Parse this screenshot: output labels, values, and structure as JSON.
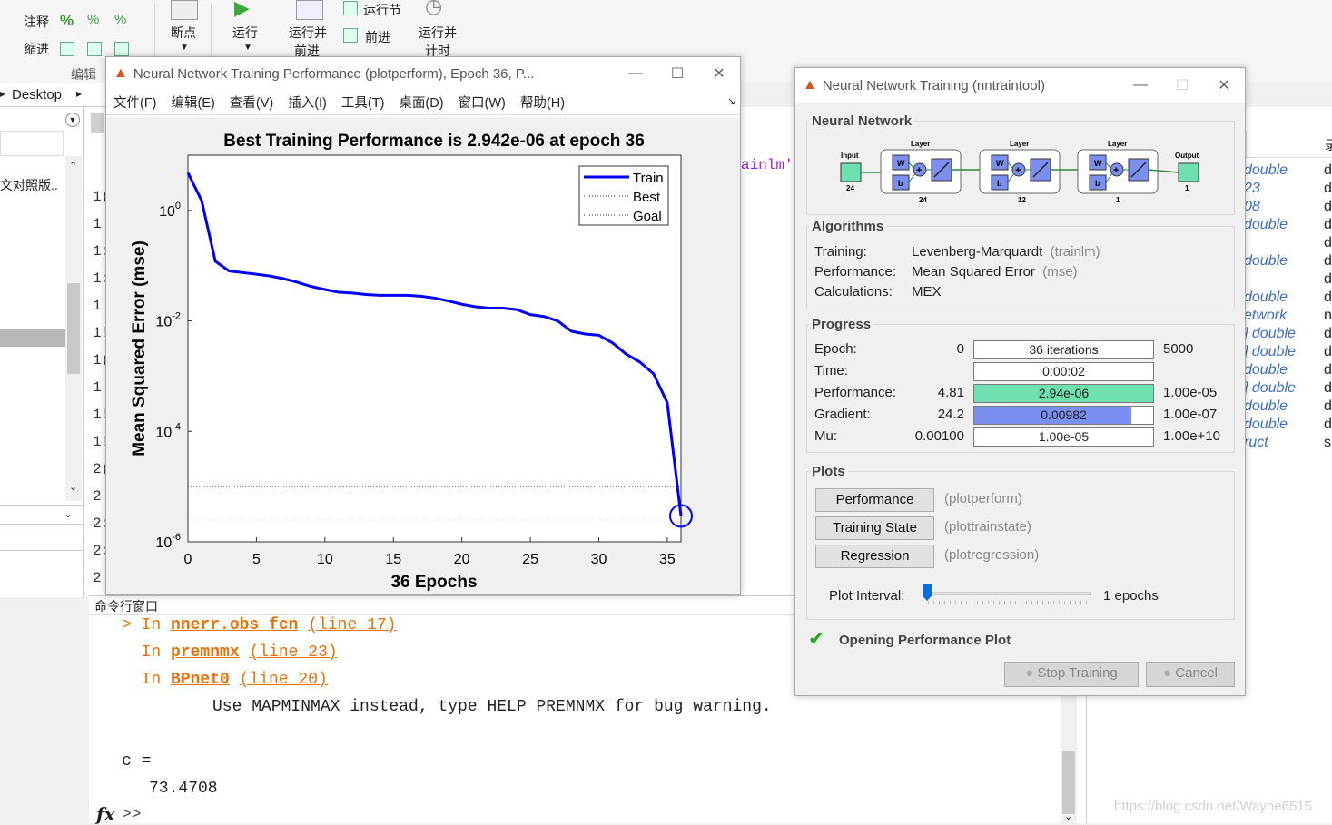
{
  "toolstrip": {
    "comment_label": "注释",
    "indent_label": "缩进",
    "edit_section": "编辑",
    "breakpoint_label": "断点",
    "run_label": "运行",
    "run_advance_l1": "运行并",
    "run_advance_l2": "前进",
    "run_section_label": "运行节",
    "advance_label": "前进",
    "run_time_l1": "运行并",
    "run_time_l2": "计时"
  },
  "address_bar": {
    "crumb": "Desktop"
  },
  "left_pane": {
    "file_item": "文对照版..",
    "line_numbers": [
      "1(",
      "1",
      "1:",
      "1:",
      "1",
      "1!",
      "1(",
      "1",
      "1!",
      "1!",
      "2(",
      "2",
      "2:",
      "2:",
      "2"
    ]
  },
  "editor_code_fragment": "ainlm'",
  "command_window": {
    "title": "命令行窗口",
    "lines": [
      {
        "prefix": "> ",
        "in": "In ",
        "func": "nnerr.obs_fcn",
        "loc": "(line 17)"
      },
      {
        "prefix": "  ",
        "in": "In ",
        "func": "premnmx",
        "loc": "(line 23)"
      },
      {
        "prefix": "  ",
        "in": "In ",
        "func": "BPnet0",
        "loc": "(line 20)"
      }
    ],
    "warning": "Use MAPMINMAX instead, type HELP PREMNMX for bug warning.",
    "var_name": "c =",
    "var_value": "73.4708",
    "fx": "fx",
    "prompt": ">>"
  },
  "workspace": {
    "header_char": "录",
    "rows": [
      {
        "t": "double",
        "d": "d"
      },
      {
        "t": "23",
        "d": "d"
      },
      {
        "t": "08",
        "d": "d"
      },
      {
        "t": "double",
        "d": "d"
      },
      {
        "t": "",
        "d": "d"
      },
      {
        "t": "double",
        "d": "d"
      },
      {
        "t": "",
        "d": "d"
      },
      {
        "t": "double",
        "d": "d"
      },
      {
        "t": "etwork",
        "d": "n"
      },
      {
        "t": "] double",
        "d": "d"
      },
      {
        "t": "] double",
        "d": "d"
      },
      {
        "t": "double",
        "d": "d"
      },
      {
        "t": "] double",
        "d": "d"
      },
      {
        "t": "double",
        "d": "d"
      },
      {
        "t": "double",
        "d": "d"
      },
      {
        "t": "ruct",
        "d": "s"
      }
    ],
    "watermark": "https://blog.csdn.net/Wayne6515"
  },
  "perf_window": {
    "title": "Neural Network Training Performance (plotperform), Epoch 36, P...",
    "menus": [
      "文件(F)",
      "编辑(E)",
      "查看(V)",
      "插入(I)",
      "工具(T)",
      "桌面(D)",
      "窗口(W)",
      "帮助(H)"
    ]
  },
  "chart_data": {
    "type": "line",
    "title": "Best Training Performance is 2.942e-06 at epoch 36",
    "xlabel": "36 Epochs",
    "ylabel": "Mean Squared Error  (mse)",
    "xlim": [
      0,
      36
    ],
    "ylim": [
      1e-06,
      10
    ],
    "yscale": "log",
    "xticks": [
      "0",
      "5",
      "10",
      "15",
      "20",
      "25",
      "30",
      "35"
    ],
    "yticks": [
      {
        "base": "10",
        "exp": "0"
      },
      {
        "base": "10",
        "exp": "-2"
      },
      {
        "base": "10",
        "exp": "-4"
      },
      {
        "base": "10",
        "exp": "-6"
      }
    ],
    "legend": [
      "Train",
      "Best",
      "Goal"
    ],
    "legend_position": "top-right",
    "series": [
      {
        "name": "Train",
        "color": "#0000ff",
        "x": [
          0,
          1,
          2,
          3,
          4,
          5,
          6,
          7,
          8,
          9,
          10,
          11,
          12,
          13,
          14,
          15,
          16,
          17,
          18,
          19,
          20,
          21,
          22,
          23,
          24,
          25,
          26,
          27,
          28,
          29,
          30,
          31,
          32,
          33,
          34,
          35,
          36
        ],
        "y": [
          4.81,
          1.5,
          0.12,
          0.08,
          0.075,
          0.07,
          0.065,
          0.058,
          0.05,
          0.042,
          0.037,
          0.033,
          0.032,
          0.03,
          0.029,
          0.029,
          0.029,
          0.028,
          0.026,
          0.023,
          0.02,
          0.018,
          0.017,
          0.017,
          0.016,
          0.013,
          0.012,
          0.01,
          0.0065,
          0.0058,
          0.0055,
          0.004,
          0.0025,
          0.0018,
          0.0011,
          0.00033,
          2.942e-06
        ]
      }
    ],
    "best_value": 2.942e-06,
    "goal_value": 1e-05,
    "best_epoch": 36
  },
  "nntool": {
    "title": "Neural Network Training (nntraintool)",
    "network_heading": "Neural Network",
    "diagram": {
      "input": "Input",
      "input_n": "24",
      "layer": "Layer",
      "w": "W",
      "b": "b",
      "layer_n": [
        "24",
        "12",
        "1"
      ],
      "output": "Output",
      "output_n": "1"
    },
    "algorithms_heading": "Algorithms",
    "training_label": "Training:",
    "training_value": "Levenberg-Marquardt",
    "training_fn": "(trainlm)",
    "performance_label": "Performance:",
    "performance_value": "Mean Squared Error",
    "performance_fn": "(mse)",
    "calculations_label": "Calculations:",
    "calculations_value": "MEX",
    "progress_heading": "Progress",
    "progress": [
      {
        "label": "Epoch:",
        "start": "0",
        "value": "36 iterations",
        "end": "5000",
        "fill": 0,
        "color": "#ffffff"
      },
      {
        "label": "Time:",
        "start": "",
        "value": "0:00:02",
        "end": "",
        "fill": 0,
        "color": "#ffffff"
      },
      {
        "label": "Performance:",
        "start": "4.81",
        "value": "2.94e-06",
        "end": "1.00e-05",
        "fill": 1.0,
        "color": "#6fe0b0"
      },
      {
        "label": "Gradient:",
        "start": "24.2",
        "value": "0.00982",
        "end": "1.00e-07",
        "fill": 0.88,
        "color": "#7b8ff0"
      },
      {
        "label": "Mu:",
        "start": "0.00100",
        "value": "1.00e-05",
        "end": "1.00e+10",
        "fill": 0,
        "color": "#ffffff"
      }
    ],
    "plots_heading": "Plots",
    "plots": [
      {
        "btn": "Performance",
        "fn": "(plotperform)"
      },
      {
        "btn": "Training State",
        "fn": "(plottrainstate)"
      },
      {
        "btn": "Regression",
        "fn": "(plotregression)"
      }
    ],
    "plot_interval_label": "Plot Interval:",
    "plot_interval_value": "1 epochs",
    "status": "Opening Performance Plot",
    "stop_label": "Stop Training",
    "cancel_label": "Cancel"
  }
}
